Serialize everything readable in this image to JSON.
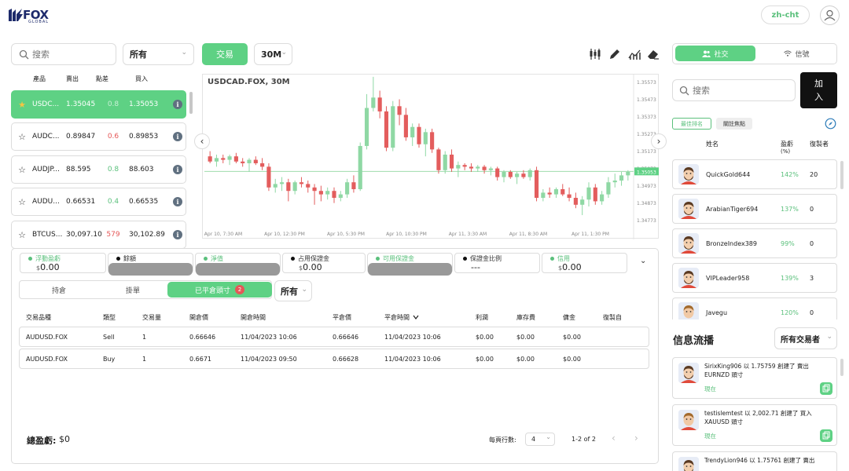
{
  "header": {
    "logo_text": "FOX",
    "logo_sub": "GLOBAL",
    "language": "zh-cht"
  },
  "left": {
    "search_placeholder": "搜索",
    "filter_value": "所有",
    "columns": [
      "產品",
      "賣出",
      "點差",
      "買入"
    ],
    "products": [
      {
        "name": "USDC...",
        "bid": "1.35045",
        "spread": "0.8",
        "ask": "1.35053",
        "spread_color": "green",
        "starred": true
      },
      {
        "name": "AUDC...",
        "bid": "0.89847",
        "spread": "0.6",
        "ask": "0.89853",
        "spread_color": "red",
        "starred": false
      },
      {
        "name": "AUDJP...",
        "bid": "88.595",
        "spread": "0.8",
        "ask": "88.603",
        "spread_color": "green",
        "starred": false
      },
      {
        "name": "AUDU...",
        "bid": "0.66531",
        "spread": "0.4",
        "ask": "0.66535",
        "spread_color": "green",
        "starred": false
      },
      {
        "name": "BTCUS...",
        "bid": "30,097.10",
        "spread": "579",
        "ask": "30,102.89",
        "spread_color": "red",
        "starred": false
      }
    ]
  },
  "toolbar": {
    "trade_label": "交易",
    "timeframe": "30M"
  },
  "chart_data": {
    "type": "candlestick",
    "title": "USDCAD.FOX, 30M",
    "y_ticks": [
      "1.35573",
      "1.35473",
      "1.35373",
      "1.35273",
      "1.35173",
      "1.35073",
      "1.34973",
      "1.34873",
      "1.34773"
    ],
    "current_price": "1.35053",
    "x_ticks": [
      "Apr 10, 7:30 AM",
      "Apr 10, 12:30 PM",
      "Apr 10, 5:30 PM",
      "Apr 10, 10:30 PM",
      "Apr 11, 3:30 AM",
      "Apr 11, 8:30 AM",
      "Apr 11, 1:30 PM"
    ],
    "ylim": [
      1.34723,
      1.35613
    ],
    "candles": [
      [
        1.3514,
        1.3517,
        1.351,
        1.3511
      ],
      [
        1.3511,
        1.3515,
        1.3508,
        1.3513
      ],
      [
        1.3513,
        1.3515,
        1.351,
        1.3512
      ],
      [
        1.3512,
        1.3515,
        1.3509,
        1.3514
      ],
      [
        1.3514,
        1.3516,
        1.351,
        1.3511
      ],
      [
        1.3511,
        1.3513,
        1.3508,
        1.351
      ],
      [
        1.351,
        1.3513,
        1.3505,
        1.3512
      ],
      [
        1.3512,
        1.3514,
        1.3509,
        1.351
      ],
      [
        1.351,
        1.3513,
        1.3506,
        1.3508
      ],
      [
        1.3508,
        1.351,
        1.3494,
        1.3496
      ],
      [
        1.3496,
        1.3501,
        1.3493,
        1.3498
      ],
      [
        1.3498,
        1.3502,
        1.3494,
        1.3499
      ],
      [
        1.3499,
        1.3501,
        1.3488,
        1.3494
      ],
      [
        1.3494,
        1.35,
        1.3492,
        1.3499
      ],
      [
        1.3499,
        1.3502,
        1.3496,
        1.3498
      ],
      [
        1.3498,
        1.35,
        1.3493,
        1.3496
      ],
      [
        1.3496,
        1.3498,
        1.3486,
        1.3494
      ],
      [
        1.3494,
        1.3497,
        1.3488,
        1.3492
      ],
      [
        1.3492,
        1.3496,
        1.3489,
        1.3494
      ],
      [
        1.3494,
        1.3496,
        1.3487,
        1.349
      ],
      [
        1.349,
        1.3494,
        1.3488,
        1.3492
      ],
      [
        1.3492,
        1.3501,
        1.349,
        1.3499
      ],
      [
        1.3499,
        1.3503,
        1.3493,
        1.3495
      ],
      [
        1.3495,
        1.3522,
        1.3494,
        1.352
      ],
      [
        1.352,
        1.355,
        1.3518,
        1.3542
      ],
      [
        1.3542,
        1.356,
        1.354,
        1.3548
      ],
      [
        1.3548,
        1.3552,
        1.3536,
        1.354
      ],
      [
        1.354,
        1.3543,
        1.3517,
        1.3519
      ],
      [
        1.3519,
        1.3546,
        1.3517,
        1.3543
      ],
      [
        1.3543,
        1.3547,
        1.3532,
        1.3538
      ],
      [
        1.3538,
        1.3542,
        1.3523,
        1.3525
      ],
      [
        1.3525,
        1.3533,
        1.352,
        1.3531
      ],
      [
        1.3531,
        1.3533,
        1.3519,
        1.3521
      ],
      [
        1.3521,
        1.353,
        1.3514,
        1.3528
      ],
      [
        1.3528,
        1.353,
        1.3516,
        1.3518
      ],
      [
        1.3518,
        1.3519,
        1.3504,
        1.3506
      ],
      [
        1.3506,
        1.3517,
        1.3504,
        1.3515
      ],
      [
        1.3515,
        1.3518,
        1.3505,
        1.3507
      ],
      [
        1.3507,
        1.3511,
        1.3502,
        1.3509
      ],
      [
        1.3509,
        1.351,
        1.3506,
        1.3508
      ],
      [
        1.3508,
        1.351,
        1.3505,
        1.3507
      ],
      [
        1.3507,
        1.3509,
        1.3505,
        1.3508
      ],
      [
        1.3508,
        1.3509,
        1.3504,
        1.3506
      ],
      [
        1.3506,
        1.3508,
        1.3503,
        1.3507
      ],
      [
        1.3507,
        1.3508,
        1.35,
        1.3502
      ],
      [
        1.3502,
        1.3506,
        1.3499,
        1.3505
      ],
      [
        1.3505,
        1.3506,
        1.3501,
        1.3502
      ],
      [
        1.3502,
        1.3505,
        1.3498,
        1.3504
      ],
      [
        1.3504,
        1.3506,
        1.3501,
        1.3502
      ],
      [
        1.3502,
        1.3507,
        1.35,
        1.3506
      ],
      [
        1.3506,
        1.3508,
        1.3488,
        1.349
      ],
      [
        1.349,
        1.3495,
        1.3488,
        1.3493
      ],
      [
        1.3493,
        1.3496,
        1.349,
        1.3492
      ],
      [
        1.3492,
        1.3496,
        1.349,
        1.3495
      ],
      [
        1.3495,
        1.3498,
        1.3491,
        1.3492
      ],
      [
        1.3492,
        1.3496,
        1.3488,
        1.349
      ],
      [
        1.349,
        1.3493,
        1.3484,
        1.3486
      ],
      [
        1.3486,
        1.3491,
        1.348,
        1.3489
      ],
      [
        1.3489,
        1.3499,
        1.3485,
        1.3496
      ],
      [
        1.3496,
        1.3498,
        1.3486,
        1.3488
      ],
      [
        1.3488,
        1.3494,
        1.3486,
        1.3492
      ],
      [
        1.3492,
        1.3502,
        1.349,
        1.3499
      ],
      [
        1.3499,
        1.3504,
        1.3496,
        1.35
      ],
      [
        1.35,
        1.3505,
        1.3497,
        1.3503
      ],
      [
        1.3503,
        1.3506,
        1.35,
        1.3505
      ]
    ]
  },
  "stats": [
    {
      "label": "浮動盈虧",
      "currency": "$",
      "value": "0.00",
      "dot": "green"
    },
    {
      "label": "餘額",
      "currency": "",
      "value": "",
      "dot": "black",
      "redacted": true
    },
    {
      "label": "淨值",
      "currency": "",
      "value": "",
      "dot": "green",
      "redacted": true
    },
    {
      "label": "占用保證金",
      "currency": "$",
      "value": "0.00",
      "dot": "black"
    },
    {
      "label": "可用保證金",
      "currency": "",
      "value": "",
      "dot": "green",
      "redacted": true
    },
    {
      "label": "保證金比例",
      "currency": "",
      "value": "---",
      "dot": "black"
    },
    {
      "label": "信用",
      "currency": "$",
      "value": "0.00",
      "dot": "green"
    }
  ],
  "tabs": {
    "positions": "持倉",
    "orders": "掛單",
    "closed": "已平倉頭寸",
    "closed_count": "2",
    "filter": "所有"
  },
  "table": {
    "headers": [
      "交易品種",
      "類型",
      "交易量",
      "開倉價",
      "開倉時間",
      "平倉價",
      "平倉時間",
      "利潤",
      "庫存費",
      "傭金",
      "復製自"
    ],
    "rows": [
      [
        "AUDUSD.FOX",
        "Sell",
        "1",
        "0.66646",
        "11/04/2023 10:06",
        "0.66646",
        "11/04/2023 10:06",
        "$0.00",
        "$0.00",
        "$0.00",
        ""
      ],
      [
        "AUDUSD.FOX",
        "Buy",
        "1",
        "0.6671",
        "11/04/2023 09:50",
        "0.66628",
        "11/04/2023 10:06",
        "$0.00",
        "$0.00",
        "$0.00",
        ""
      ]
    ]
  },
  "footer": {
    "total_label": "總盈虧:",
    "total_value": "$0",
    "rows_per_page_label": "每頁行數:",
    "rows_per_page": "4",
    "page_range": "1-2 of 2"
  },
  "right": {
    "tab_social": "社交",
    "tab_signal": "信號",
    "search_placeholder": "搜索",
    "join_label": "加入",
    "chip_best": "最佳排名",
    "chip_follow": "關註焦點",
    "col_name": "姓名",
    "col_profit": "盈虧",
    "col_profit_unit": "(%)",
    "col_copiers": "復製者",
    "ranking": [
      {
        "name": "QuickGold644",
        "profit": "142%",
        "copiers": "20"
      },
      {
        "name": "ArabianTiger694",
        "profit": "137%",
        "copiers": "0"
      },
      {
        "name": "BronzeIndex389",
        "profit": "99%",
        "copiers": "0"
      },
      {
        "name": "VIPLeader958",
        "profit": "139%",
        "copiers": "3"
      },
      {
        "name": "Javegu",
        "profit": "120%",
        "copiers": "0"
      }
    ],
    "feed_title": "信息流播",
    "feed_filter": "所有交易者",
    "feed": [
      {
        "line1": "SirixKing906 以 1.75759 創建了 賣出",
        "line2": "EURNZD 頭寸",
        "time": "現在"
      },
      {
        "line1": "testislemtest 以 2,002.71 創建了 買入",
        "line2": "XAUUSD 頭寸",
        "time": "現在"
      },
      {
        "line1": "TrendyLion946 以 1.75761 創建了 賣出",
        "line2": "",
        "time": ""
      }
    ]
  }
}
